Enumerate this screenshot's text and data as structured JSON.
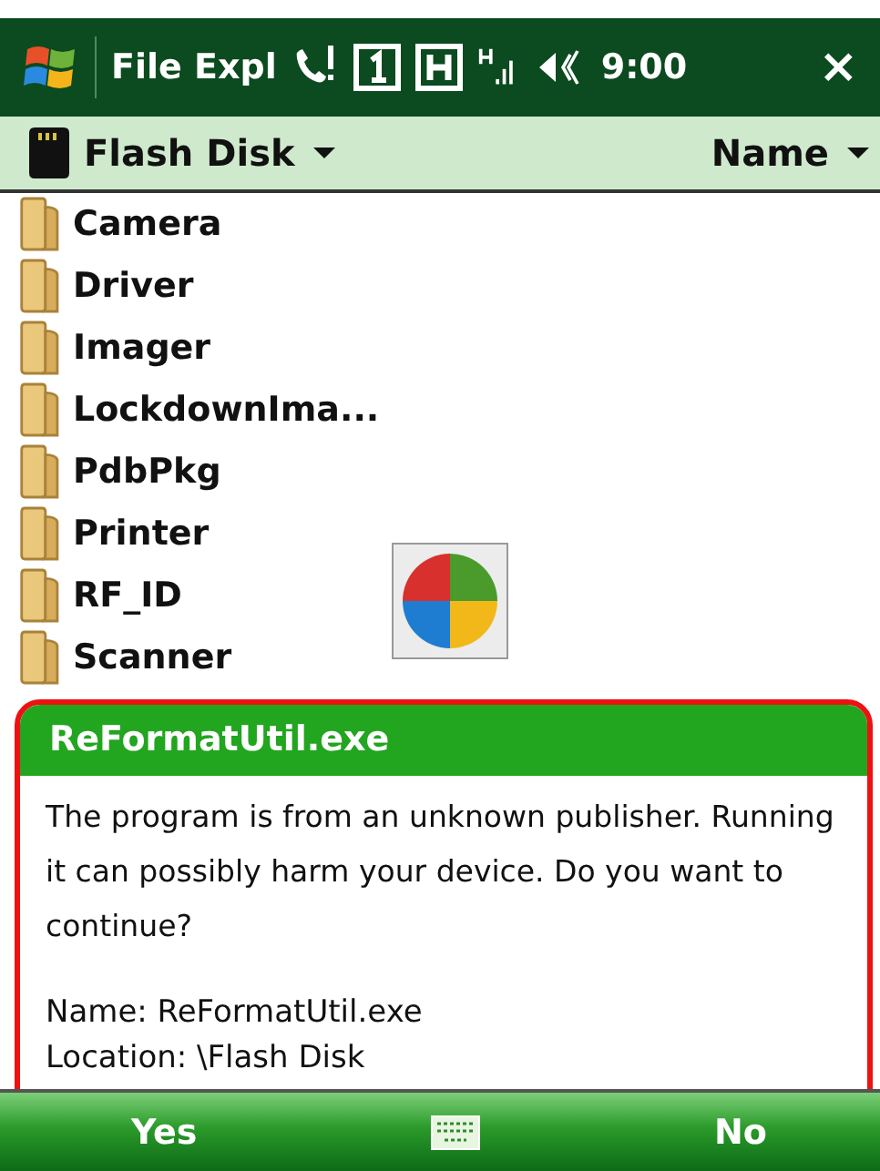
{
  "status_bar": {
    "app_title": "File Expl",
    "time": "9:00",
    "close": "×"
  },
  "header": {
    "location": "Flash Disk",
    "sort": "Name"
  },
  "folders": [
    {
      "name": "Camera"
    },
    {
      "name": "Driver"
    },
    {
      "name": "Imager"
    },
    {
      "name": "LockdownIma..."
    },
    {
      "name": "PdbPkg"
    },
    {
      "name": "Printer"
    },
    {
      "name": "RF_ID"
    },
    {
      "name": "Scanner"
    }
  ],
  "dialog": {
    "title": "ReFormatUtil.exe",
    "message": "The program is from an unknown publisher. Running it can possibly harm your device. Do you want to continue?",
    "details": [
      "Name: ReFormatUtil.exe",
      "Location: \\Flash Disk"
    ]
  },
  "softkeys": {
    "left": "Yes",
    "right": "No"
  }
}
